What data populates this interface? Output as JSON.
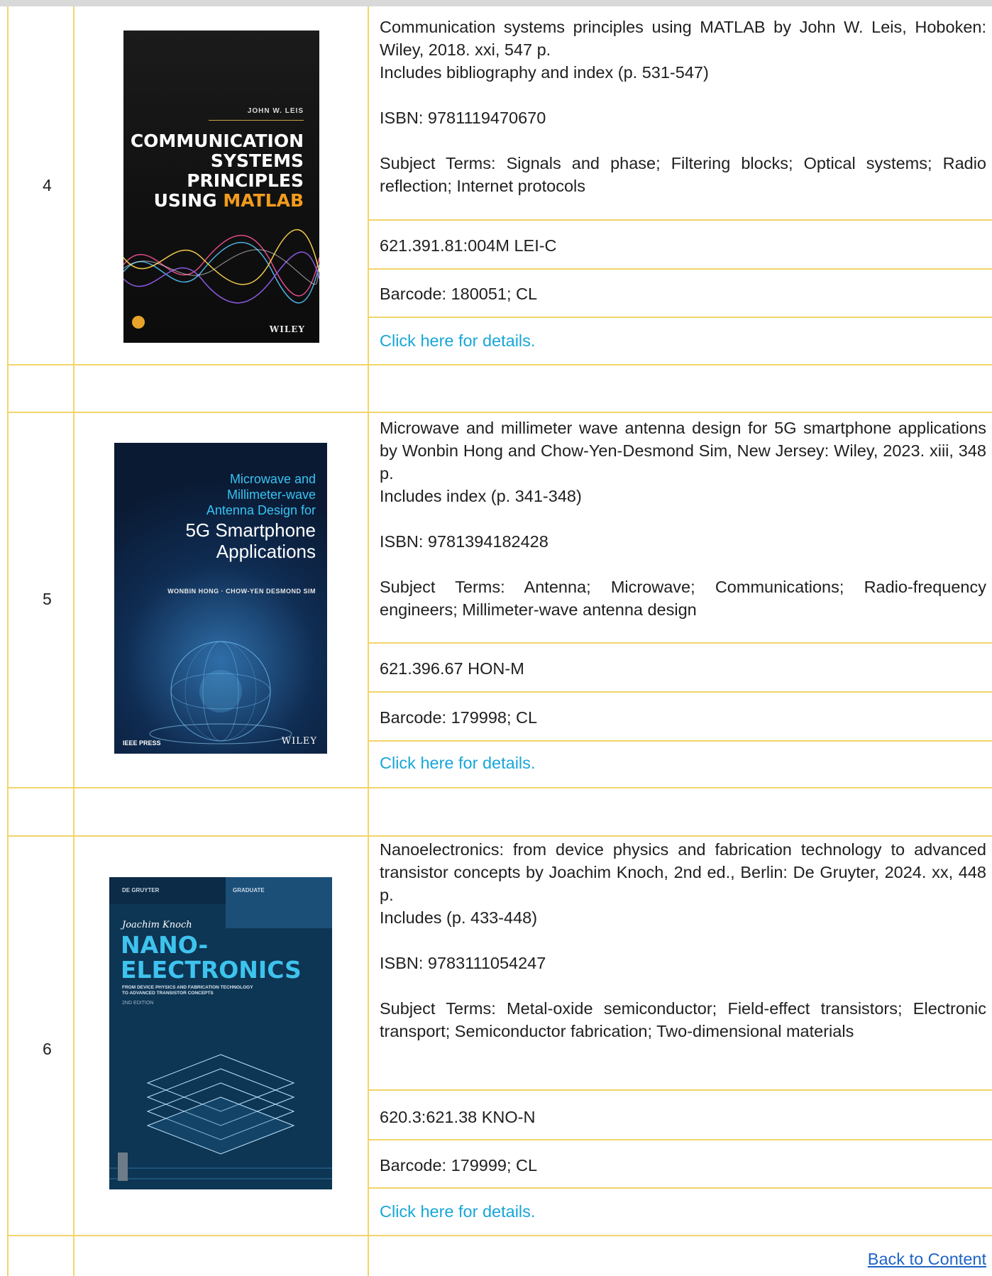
{
  "entries": [
    {
      "number": "4",
      "cover": {
        "author": "JOHN W. LEIS",
        "title_lines": [
          "COMMUNICATION",
          "SYSTEMS",
          "PRINCIPLES"
        ],
        "title_last": "USING ",
        "title_highlight": "MATLAB",
        "publisher": "WILEY"
      },
      "description_lines": [
        "Communication systems principles using MATLAB by John W. Leis, Hoboken: Wiley, 2018. xxi, 547 p.",
        "Includes bibliography and index (p. 531-547)"
      ],
      "isbn": "ISBN: 9781119470670",
      "subjects": "Subject Terms: Signals and phase; Filtering blocks; Optical systems; Radio reflection; Internet protocols",
      "call_number": "621.391.81:004M LEI-C",
      "barcode": "Barcode: 180051; CL",
      "details_link": "Click here for details."
    },
    {
      "number": "5",
      "cover": {
        "subtitle_lines": [
          "Microwave and",
          "Millimeter-wave",
          "Antenna Design for"
        ],
        "title_lines": [
          "5G Smartphone",
          "Applications"
        ],
        "authors": "WONBIN HONG · CHOW-YEN DESMOND SIM",
        "imprint": "IEEE PRESS",
        "publisher": "WILEY"
      },
      "description_lines": [
        "Microwave and millimeter wave antenna design for 5G smartphone applications by Wonbin Hong and Chow-Yen-Desmond Sim, New Jersey: Wiley, 2023. xiii, 348 p.",
        "Includes index (p. 341-348)"
      ],
      "isbn": "ISBN: 9781394182428",
      "subjects": "Subject Terms: Antenna; Microwave; Communications; Radio-frequency engineers; Millimeter-wave antenna design",
      "call_number": "621.396.67 HON-M",
      "barcode": "Barcode: 179998; CL",
      "details_link": "Click here for details."
    },
    {
      "number": "6",
      "cover": {
        "publisher": "DE GRUYTER",
        "series": "GRADUATE",
        "author": "Joachim Knoch",
        "title_lines": [
          "NANO-",
          "ELECTRONICS"
        ],
        "subtitle_lines": [
          "FROM DEVICE PHYSICS AND FABRICATION TECHNOLOGY",
          "TO ADVANCED TRANSISTOR CONCEPTS"
        ],
        "edition": "2ND EDITION"
      },
      "description_lines": [
        "Nanoelectronics: from device physics and fabrication technology to advanced transistor concepts by Joachim Knoch, 2nd ed., Berlin: De Gruyter, 2024. xx, 448 p.",
        "Includes (p. 433-448)"
      ],
      "isbn": "ISBN: 9783111054247",
      "subjects": "Subject Terms: Metal-oxide semiconductor; Field-effect transistors; Electronic transport; Semiconductor fabrication; Two-dimensional materials",
      "call_number": "620.3:621.38 KNO-N",
      "barcode": "Barcode: 179999; CL",
      "details_link": "Click here for details."
    }
  ],
  "back_link": "Back to Content",
  "colors": {
    "border": "#f2d56a",
    "link": "#18a6d9",
    "back_link": "#1f63c6"
  }
}
